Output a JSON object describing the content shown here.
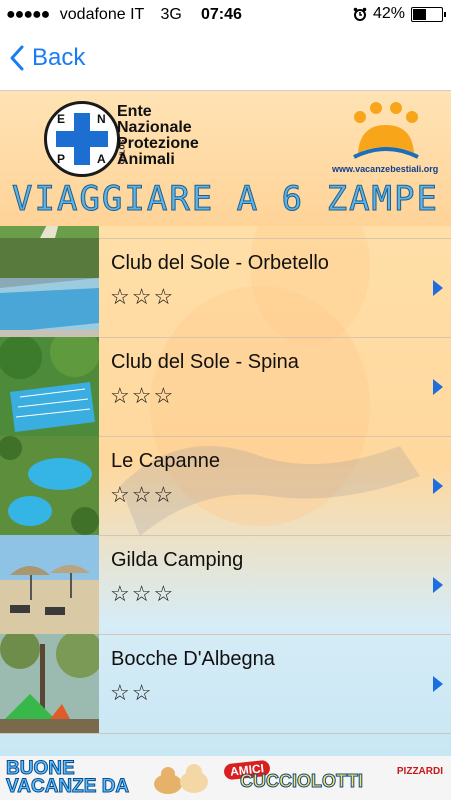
{
  "status_bar": {
    "carrier": "vodafone IT",
    "network": "3G",
    "time": "07:46",
    "battery_percent": "42%",
    "battery_level": 0.42,
    "signal_bars": "●●●●●"
  },
  "nav": {
    "back_label": "Back"
  },
  "header": {
    "org_logo_letters": [
      "E",
      "N",
      "P",
      "A"
    ],
    "org_name_lines": [
      "Ente",
      "Nazionale",
      "Protezione",
      "Animali"
    ],
    "org_onlus": "ONLUS",
    "site": "www.vacanzebestiali.org",
    "banner_title": "VIAGGIARE A 6 ZAMPE"
  },
  "list": {
    "partial_top_stars": "☆☆☆",
    "items": [
      {
        "name": "Club del Sole - Orbetello",
        "stars": "☆☆☆",
        "photo": "pool-photo"
      },
      {
        "name": "Club del Sole - Spina",
        "stars": "☆☆☆",
        "photo": "pool-photo"
      },
      {
        "name": "Le Capanne",
        "stars": "☆☆☆",
        "photo": "pool-photo"
      },
      {
        "name": "Gilda Camping",
        "stars": "☆☆☆",
        "photo": "beach-photo"
      },
      {
        "name": "Bocche D'Albegna",
        "stars": "☆☆",
        "photo": "camping-photo"
      }
    ]
  },
  "footer": {
    "slogan_lines": [
      "BUONE",
      "VACANZE DA"
    ],
    "brand_tag": "AMICI",
    "brand": "CUCCIOLOTTI",
    "sponsor": "PIZZARDI"
  },
  "colors": {
    "ios_blue": "#1b7cf2",
    "header_bg": "#ffd9a0",
    "title_blue": "#4aa3d8",
    "chevron": "#1d6fe0"
  }
}
